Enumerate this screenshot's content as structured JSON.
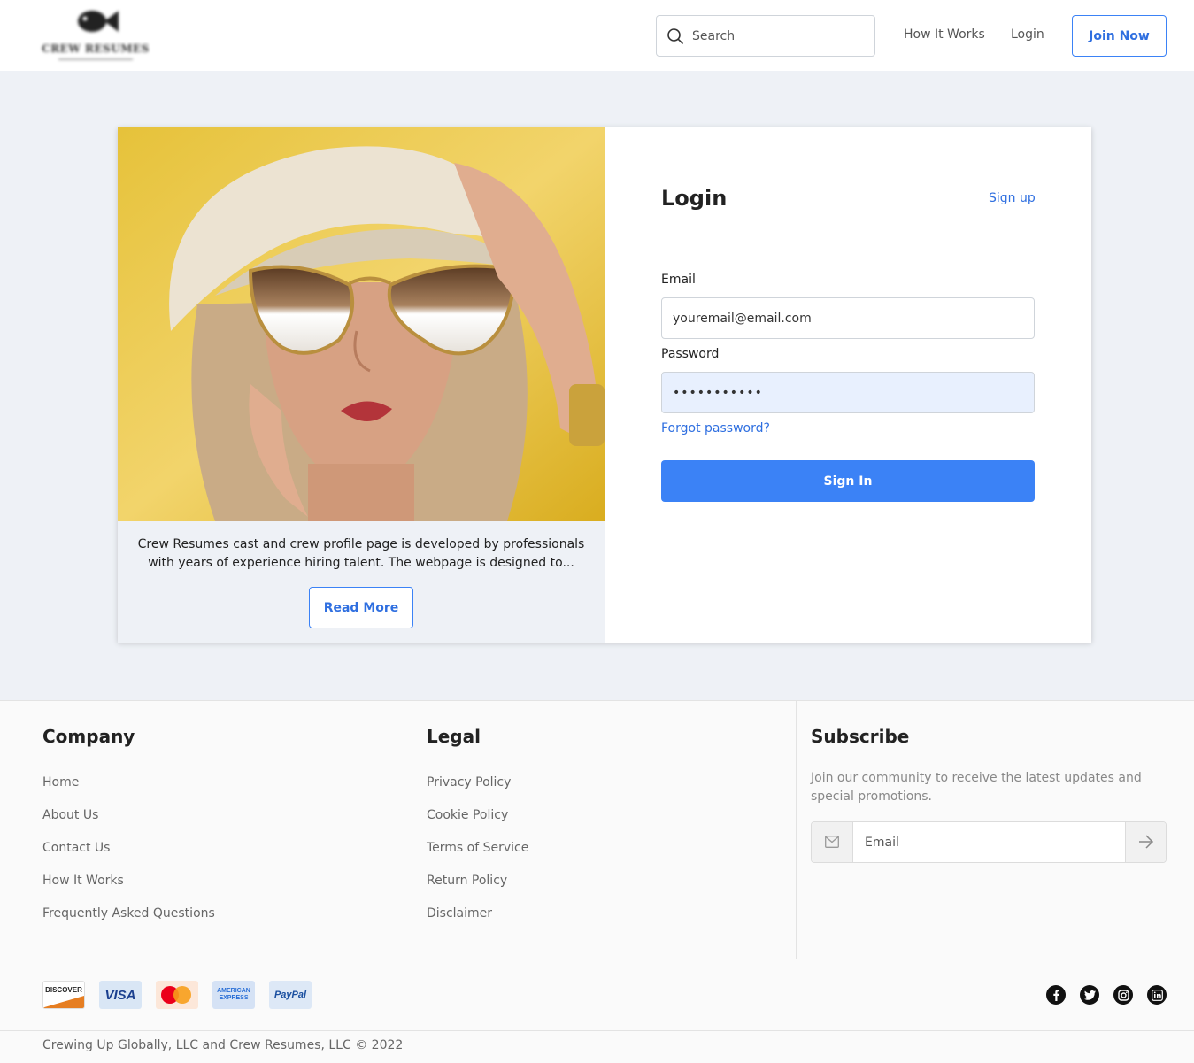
{
  "header": {
    "logo_text": "CREW RESUMES",
    "search_placeholder": "Search",
    "nav_how_it_works": "How It Works",
    "nav_login": "Login",
    "join_now": "Join Now"
  },
  "promo": {
    "text": "Crew Resumes cast and crew profile page is developed by professionals with years of experience hiring talent. The webpage is designed to...",
    "read_more": "Read More"
  },
  "login": {
    "title": "Login",
    "signup": "Sign up",
    "email_label": "Email",
    "email_value": "youremail@email.com",
    "password_label": "Password",
    "password_value": "•••••••••••",
    "forgot": "Forgot password?",
    "sign_in": "Sign In"
  },
  "footer": {
    "company": {
      "title": "Company",
      "links": [
        "Home",
        "About Us",
        "Contact Us",
        "How It Works",
        "Frequently Asked Questions"
      ]
    },
    "legal": {
      "title": "Legal",
      "links": [
        "Privacy Policy",
        "Cookie Policy",
        "Terms of Service",
        "Return Policy",
        "Disclaimer"
      ]
    },
    "subscribe": {
      "title": "Subscribe",
      "text": "Join our community to receive the latest updates and special promotions.",
      "email_placeholder": "Email"
    },
    "payments": {
      "discover": "DISCOVER",
      "visa": "VISA",
      "amex": "AMERICAN EXPRESS",
      "paypal": "PayPal"
    },
    "social_icons": [
      "facebook-icon",
      "twitter-icon",
      "instagram-icon",
      "linkedin-icon"
    ],
    "copyright": "Crewing Up Globally, LLC and Crew Resumes, LLC © 2022"
  },
  "colors": {
    "accent": "#3b82f6",
    "link": "#2f6fe0",
    "page_bg": "#eef1f6"
  }
}
